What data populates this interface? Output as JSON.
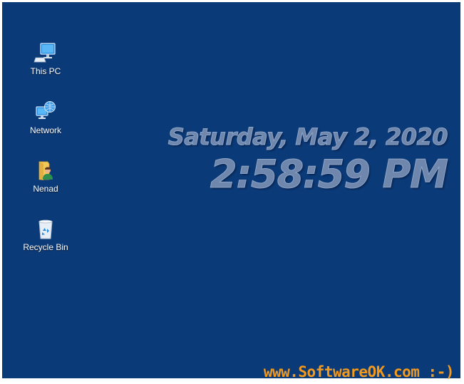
{
  "desktop": {
    "background_color": "#0b3a78",
    "icons": [
      {
        "label": "This PC",
        "icon": "this-pc-icon"
      },
      {
        "label": "Network",
        "icon": "network-icon"
      },
      {
        "label": "Nenad",
        "icon": "user-folder-icon"
      },
      {
        "label": "Recycle Bin",
        "icon": "recycle-bin-icon"
      }
    ]
  },
  "clock": {
    "date": "Saturday, May 2, 2020",
    "time": "2:58:59 PM"
  },
  "watermark": {
    "text": "www.SoftwareOK.com :-)",
    "color": "#f39a1c"
  }
}
